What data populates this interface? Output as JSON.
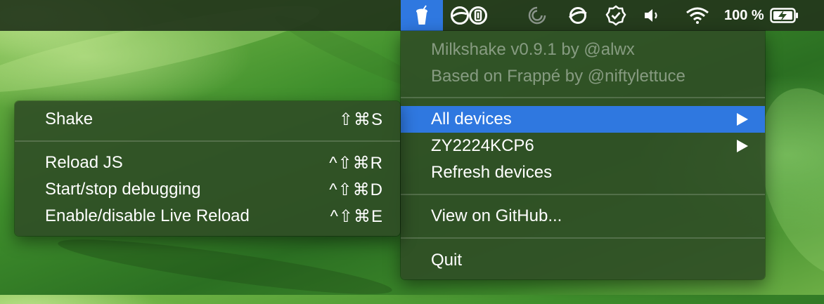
{
  "menubar": {
    "status_items": [
      {
        "icon": "milkshake-icon",
        "selected": true
      },
      {
        "icon": "circle-slash-icon"
      },
      {
        "icon": "one-password-icon"
      },
      {
        "icon": "spinner-icon"
      },
      {
        "icon": "planet-icon"
      },
      {
        "icon": "check-badge-icon"
      },
      {
        "icon": "volume-icon"
      },
      {
        "icon": "wifi-icon"
      }
    ],
    "battery_percent": "100 %",
    "battery_icon": "battery-charging-icon"
  },
  "main_menu": {
    "header_line1": "Milkshake v0.9.1 by @alwx",
    "header_line2": "Based on Frappé by @niftylettuce",
    "items": {
      "all_devices": "All devices",
      "device": "ZY2224KCP6",
      "refresh": "Refresh devices",
      "github": "View on GitHub...",
      "quit": "Quit"
    },
    "highlight_color": "#2f78e0"
  },
  "submenu": {
    "items": [
      {
        "label": "Shake",
        "shortcut": "⇧⌘S"
      },
      {
        "label": "Reload JS",
        "shortcut": "^⇧⌘R"
      },
      {
        "label": "Start/stop debugging",
        "shortcut": "^⇧⌘D"
      },
      {
        "label": "Enable/disable Live Reload",
        "shortcut": "^⇧⌘E"
      }
    ]
  }
}
